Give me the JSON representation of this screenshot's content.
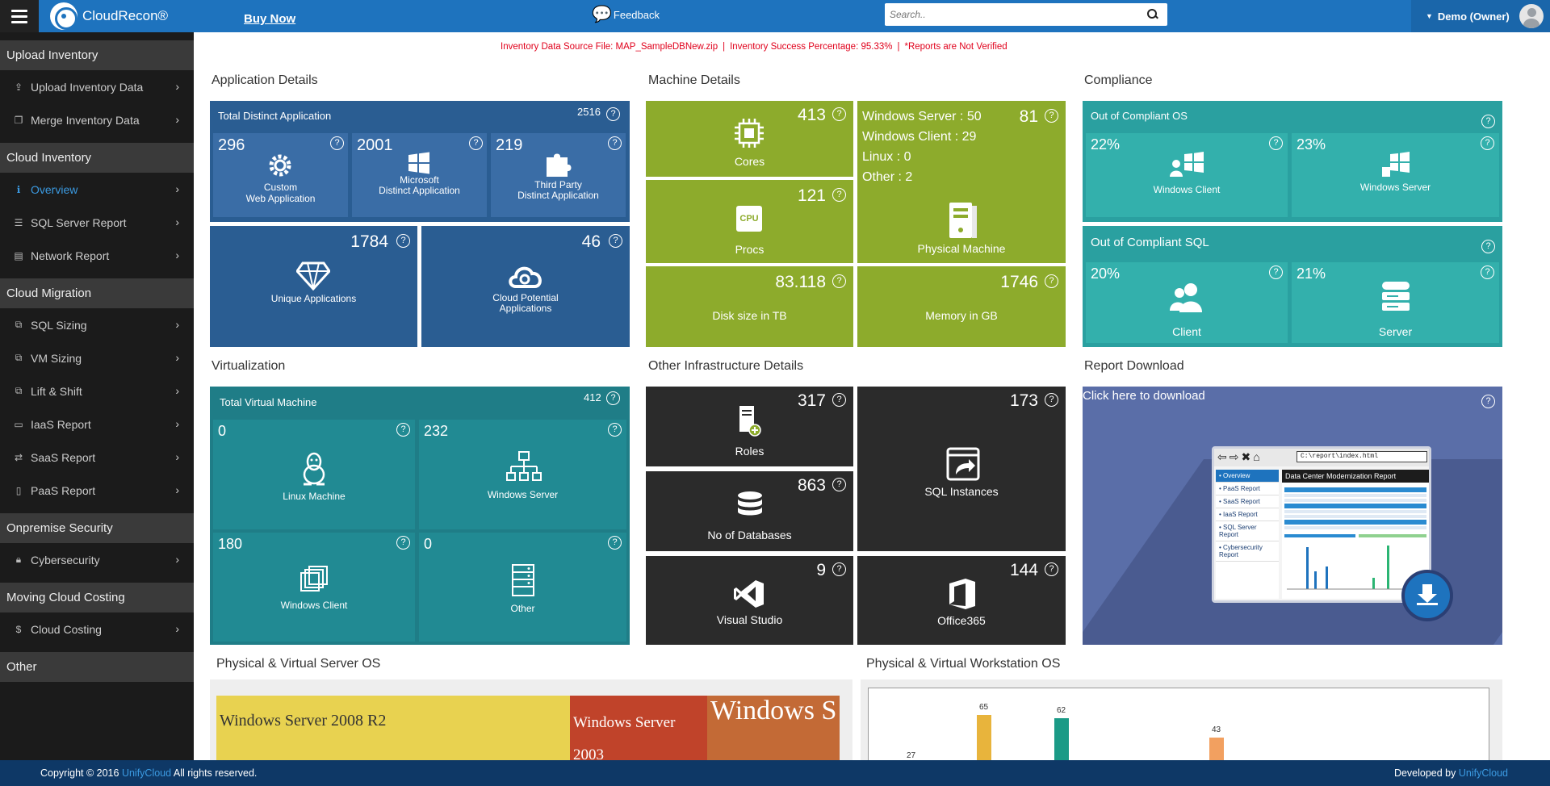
{
  "topbar": {
    "app_name": "CloudRecon®",
    "buy_now": "Buy Now",
    "feedback": "Feedback",
    "search_placeholder": "Search..",
    "user": "Demo (Owner)"
  },
  "sidebar": {
    "sections": [
      {
        "title": "Upload Inventory",
        "items": [
          {
            "label": "Upload Inventory Data",
            "icon": "upload-icon"
          },
          {
            "label": "Merge Inventory Data",
            "icon": "merge-icon"
          }
        ]
      },
      {
        "title": "Cloud Inventory",
        "items": [
          {
            "label": "Overview",
            "icon": "info-icon",
            "active": true
          },
          {
            "label": "SQL Server Report",
            "icon": "database-icon"
          },
          {
            "label": "Network Report",
            "icon": "network-icon"
          }
        ]
      },
      {
        "title": "Cloud Migration",
        "items": [
          {
            "label": "SQL Sizing",
            "icon": "sizing-icon"
          },
          {
            "label": "VM Sizing",
            "icon": "sizing-icon"
          },
          {
            "label": "Lift & Shift",
            "icon": "sizing-icon"
          },
          {
            "label": "IaaS Report",
            "icon": "monitor-icon"
          },
          {
            "label": "SaaS Report",
            "icon": "exchange-icon"
          },
          {
            "label": "PaaS Report",
            "icon": "file-icon"
          }
        ]
      },
      {
        "title": "Onpremise Security",
        "items": [
          {
            "label": "Cybersecurity",
            "icon": "lock-icon"
          }
        ]
      },
      {
        "title": "Moving Cloud Costing",
        "items": [
          {
            "label": "Cloud Costing",
            "icon": "dollar-icon"
          }
        ]
      },
      {
        "title": "Other",
        "items": []
      }
    ]
  },
  "notice": {
    "source": "Inventory Data Source File: MAP_SampleDBNew.zip",
    "success": "Inventory Success Percentage: 95.33%",
    "warning": "*Reports are Not Verified"
  },
  "sections": {
    "application": "Application Details",
    "machine": "Machine Details",
    "compliance": "Compliance",
    "virtualization": "Virtualization",
    "other_infra": "Other Infrastructure Details",
    "report_download": "Report Download",
    "server_os": "Physical & Virtual Server OS",
    "workstation_os": "Physical & Virtual Workstation OS"
  },
  "application": {
    "total_label": "Total Distinct Application",
    "total_value": "2516",
    "custom_value": "296",
    "custom_label_1": "Custom",
    "custom_label_2": "Web Application",
    "ms_value": "2001",
    "ms_label_1": "Microsoft",
    "ms_label_2": "Distinct Application",
    "tp_value": "219",
    "tp_label_1": "Third Party",
    "tp_label_2": "Distinct Application",
    "unique_value": "1784",
    "unique_label": "Unique Applications",
    "cloud_value": "46",
    "cloud_label_1": "Cloud Potential",
    "cloud_label_2": "Applications"
  },
  "machine": {
    "cores_value": "413",
    "cores_label": "Cores",
    "procs_value": "121",
    "procs_label": "Procs",
    "cpu_chip_text": "CPU",
    "physical_value": "81",
    "physical_label": "Physical Machine",
    "win_server": "Windows Server : 50",
    "win_client": "Windows Client : 29",
    "linux": "Linux : 0",
    "other": "Other : 2",
    "disk_value": "83.118",
    "disk_label": "Disk size in TB",
    "memory_value": "1746",
    "memory_label": "Memory in GB"
  },
  "compliance": {
    "os_title": "Out of Compliant OS",
    "os_client_pct": "22%",
    "os_client_label": "Windows Client",
    "os_server_pct": "23%",
    "os_server_label": "Windows Server",
    "sql_title": "Out of Compliant SQL",
    "sql_client_pct": "20%",
    "sql_client_label": "Client",
    "sql_server_pct": "21%",
    "sql_server_label": "Server"
  },
  "virtualization": {
    "total_label": "Total Virtual Machine",
    "total_value": "412",
    "linux_value": "0",
    "linux_label": "Linux Machine",
    "winserver_value": "232",
    "winserver_label": "Windows Server",
    "winclient_value": "180",
    "winclient_label": "Windows Client",
    "other_value": "0",
    "other_label": "Other"
  },
  "infra": {
    "roles_value": "317",
    "roles_label": "Roles",
    "sqlinst_value": "173",
    "sqlinst_label": "SQL Instances",
    "db_value": "863",
    "db_label": "No of Databases",
    "vs_value": "9",
    "vs_label": "Visual Studio",
    "o365_value": "144",
    "o365_label": "Office365"
  },
  "report": {
    "link": "Click here to download",
    "url": "C:\\report\\index.html",
    "title": "Data Center Modernization Report",
    "nav": [
      "Overview",
      "PaaS Report",
      "SaaS Report",
      "IaaS Report",
      "SQL Server Report",
      "Cybersecurity Report"
    ]
  },
  "server_os": {
    "cells": [
      {
        "label": "Windows Server 2008 R2",
        "color": "#e8d250"
      },
      {
        "label": "Windows Server 2003",
        "color": "#c0432a"
      },
      {
        "label": "Windows S",
        "color": "#c36a36"
      }
    ]
  },
  "chart_data": {
    "type": "bar",
    "title": "Physical & Virtual Workstation OS",
    "visible_values": [
      27,
      65,
      62,
      43
    ],
    "colors": [
      "#cccccc",
      "#e8b43c",
      "#1a9a86",
      "#f2a060"
    ]
  },
  "footer": {
    "copyright_prefix": "Copyright © 2016 ",
    "brand": "UnifyCloud",
    "copyright_suffix": " All rights reserved.",
    "developed_by": "Developed by "
  },
  "help_mark": "?"
}
